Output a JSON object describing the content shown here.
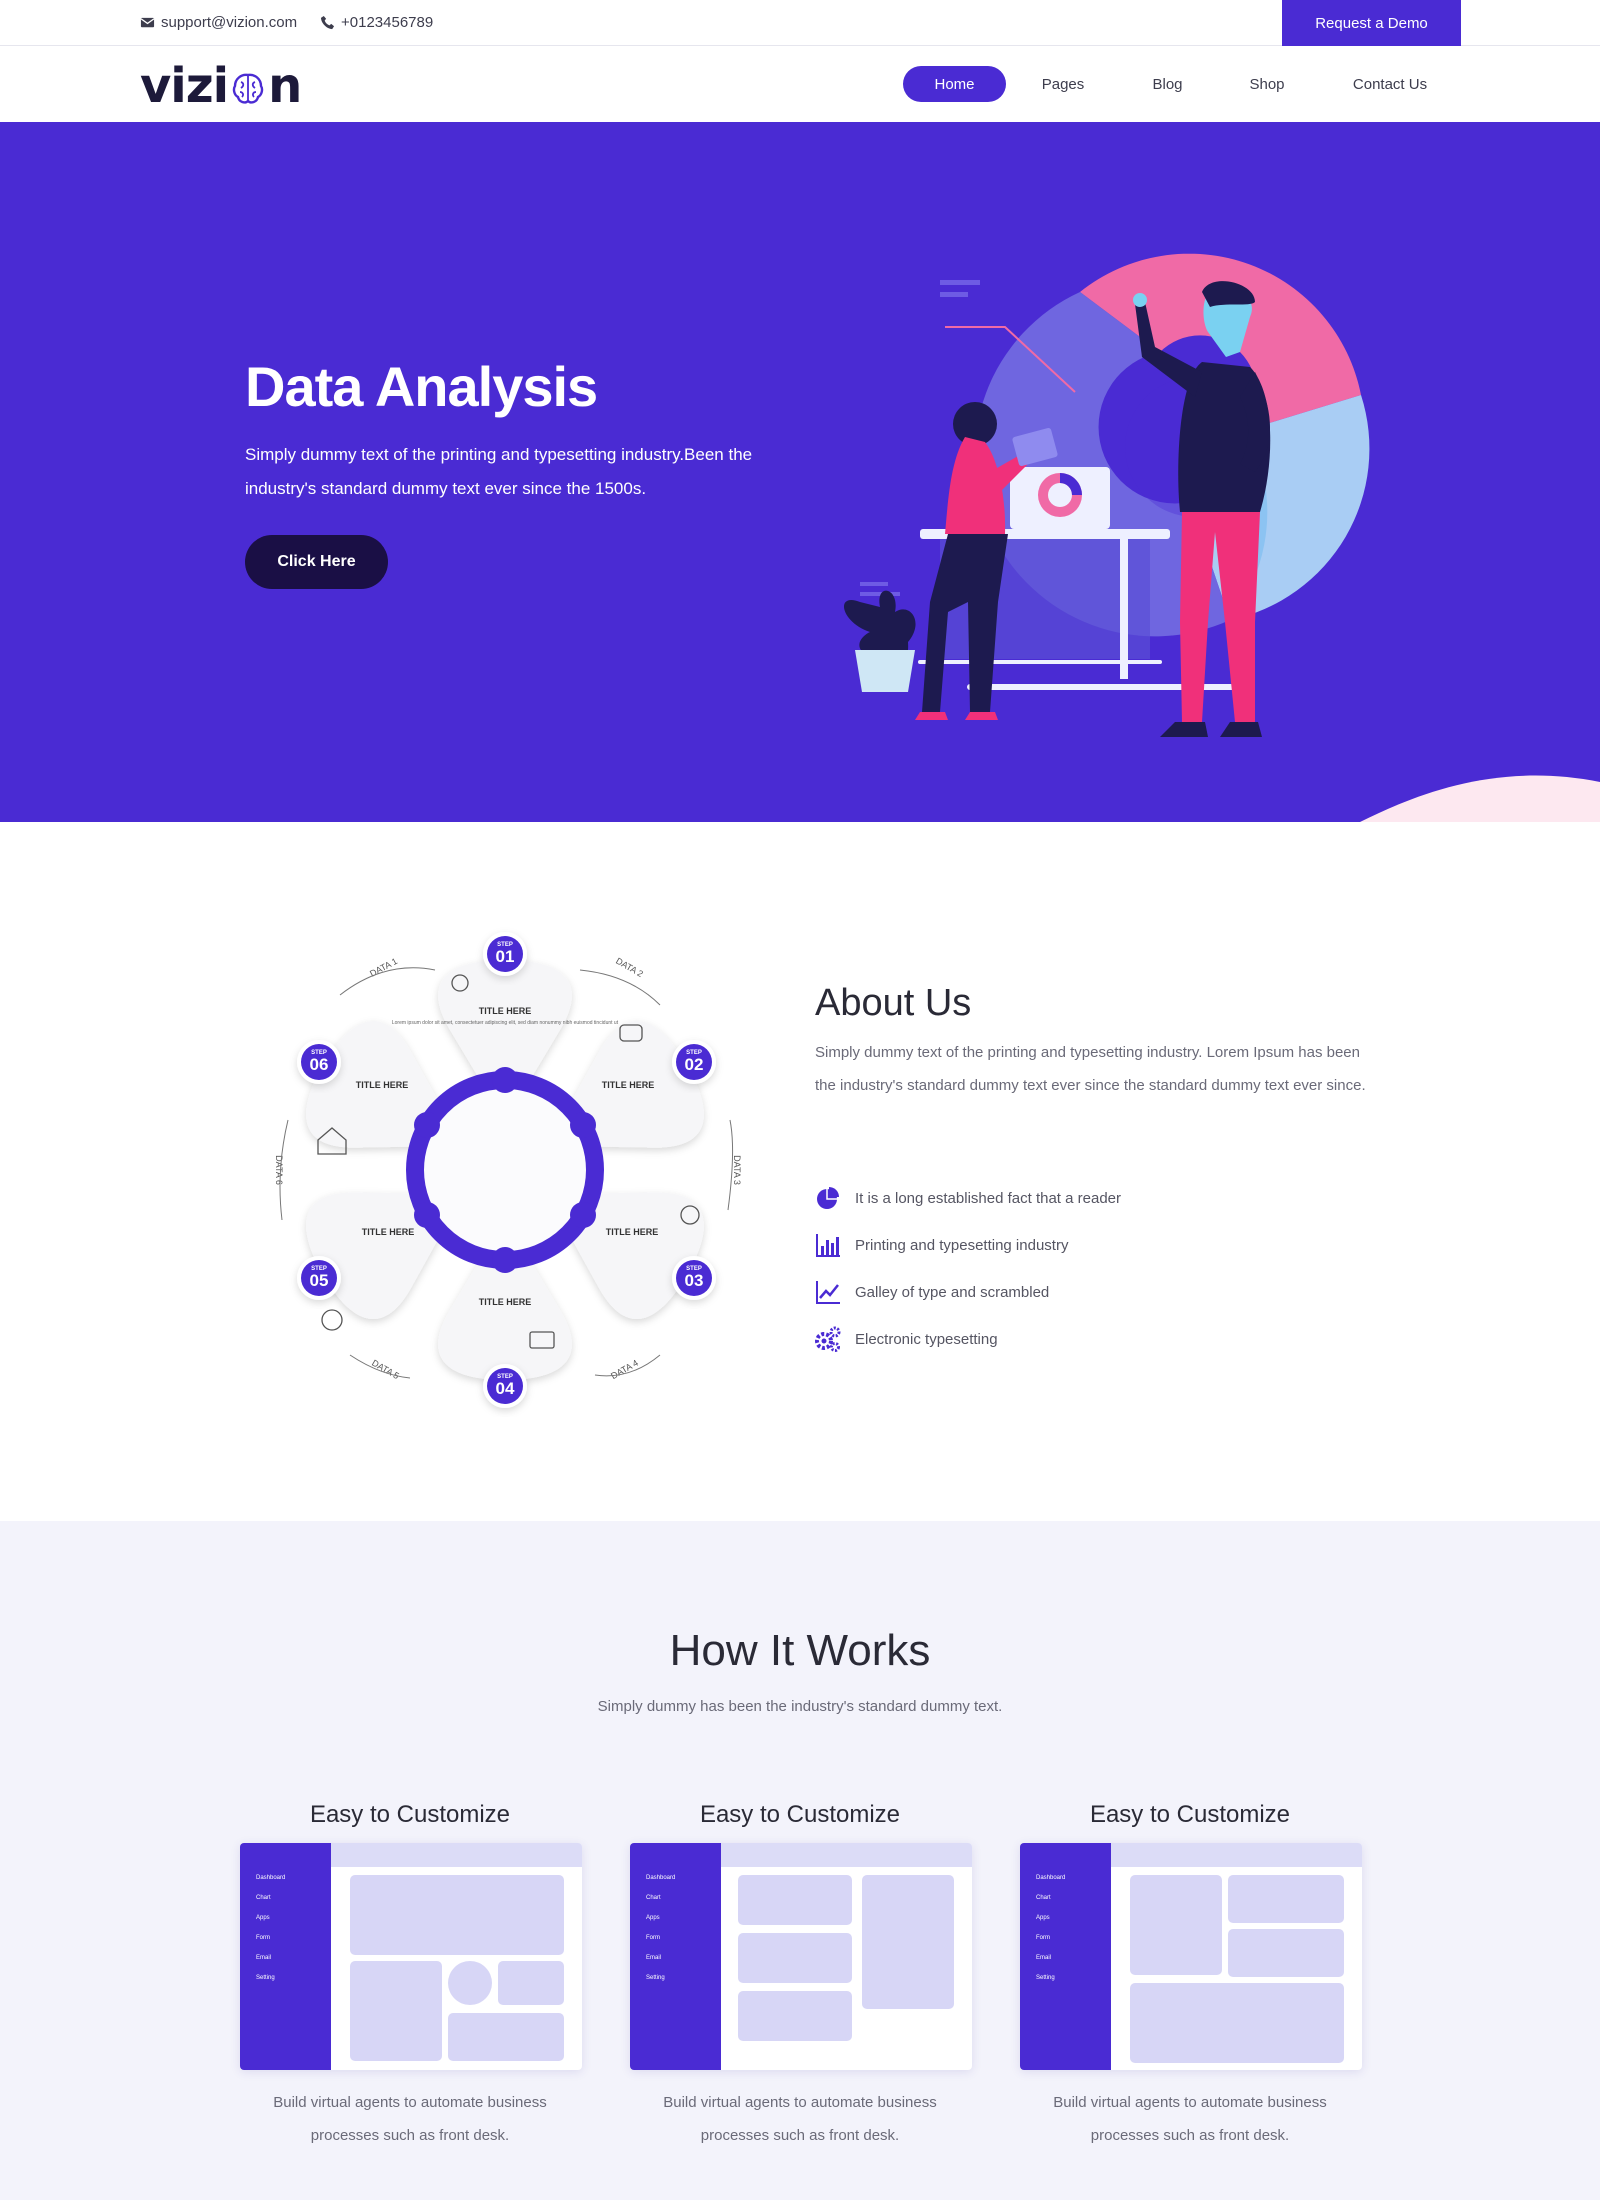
{
  "topbar": {
    "email": "support@vizion.com",
    "phone": "+0123456789",
    "demo_label": "Request a Demo"
  },
  "brand": {
    "logo_text_left": "vizi",
    "logo_text_right": "n",
    "accent": "#4a2bd3"
  },
  "nav": {
    "items": [
      "Home",
      "Pages",
      "Blog",
      "Shop",
      "Contact Us"
    ],
    "active": "Home"
  },
  "hero": {
    "title": "Data Analysis",
    "text": "Simply dummy text of the printing and typesetting industry.Been the industry's standard dummy text ever since the 1500s.",
    "button_label": "Click Here"
  },
  "about": {
    "title": "About Us",
    "text": "Simply dummy text of the printing and typesetting industry. Lorem Ipsum has been the industry's standard dummy text ever since the standard dummy text ever since.",
    "features": [
      {
        "icon": "pie-chart-icon",
        "label": "It is a long established fact that a reader"
      },
      {
        "icon": "bar-chart-icon",
        "label": "Printing and typesetting industry"
      },
      {
        "icon": "line-chart-icon",
        "label": "Galley of type and scrambled"
      },
      {
        "icon": "gears-icon",
        "label": "Electronic typesetting"
      }
    ],
    "infographic": {
      "step_word": "STEP",
      "steps": [
        "01",
        "02",
        "03",
        "04",
        "05",
        "06"
      ],
      "data_labels": [
        "DATA 1",
        "DATA 2",
        "DATA 3",
        "DATA 4",
        "DATA 5",
        "DATA 6"
      ],
      "petal_title": "TITLE HERE",
      "petal_text": "Lorem ipsum dolor sit amet, consectetuer adipiscing elit, sed diam nonummy nibh euismod tincidunt ut"
    }
  },
  "how": {
    "title": "How It Works",
    "subtitle": "Simply dummy has been the industry's standard dummy text.",
    "cards": [
      {
        "title": "Easy to Customize",
        "text": "Build virtual agents to automate business processes such as front desk."
      },
      {
        "title": "Easy to Customize",
        "text": "Build virtual agents to automate business processes such as front desk."
      },
      {
        "title": "Easy to Customize",
        "text": "Build virtual agents to automate business processes such as front desk."
      }
    ],
    "dashboard_menu": [
      "Dashboard",
      "Chart",
      "Apps",
      "Form",
      "Email",
      "Setting"
    ]
  }
}
